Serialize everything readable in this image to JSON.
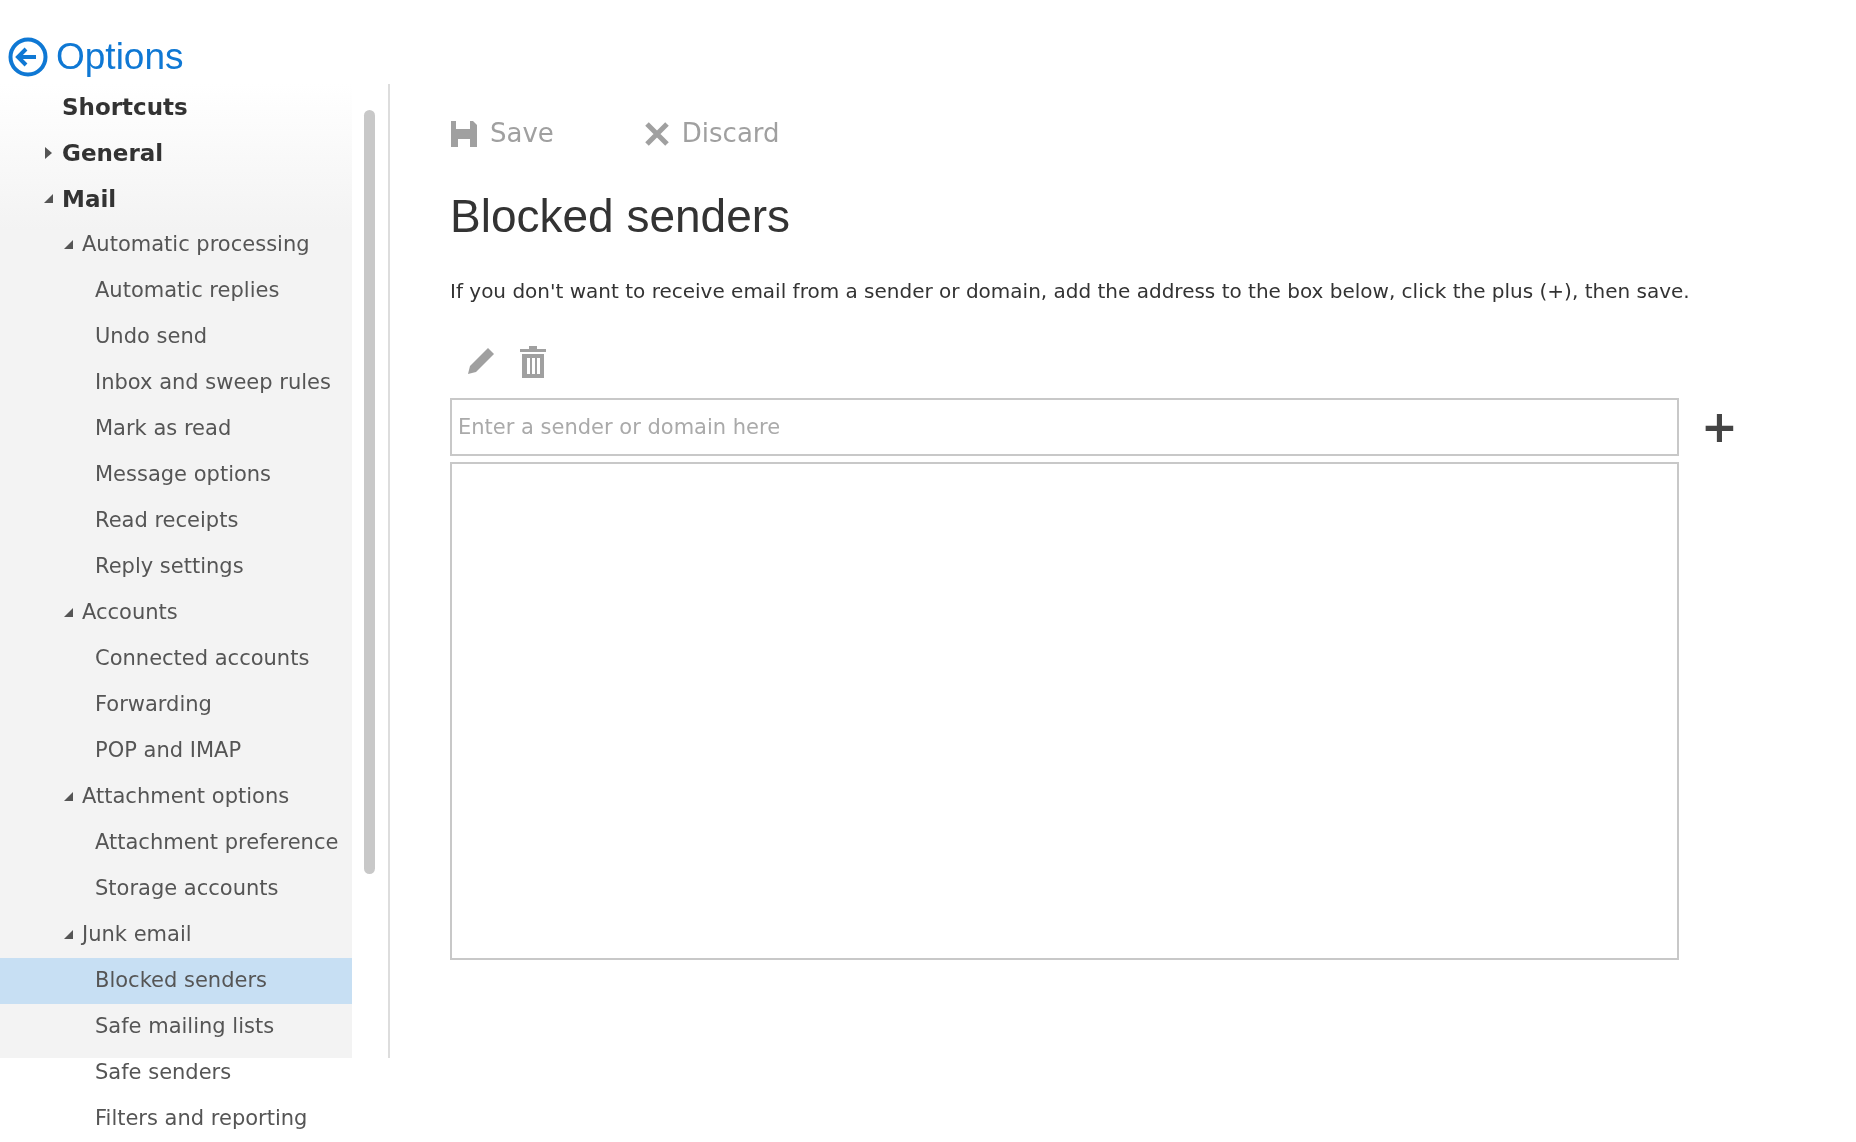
{
  "header": {
    "title": "Options"
  },
  "sidebar": {
    "items": [
      {
        "label": "Shortcuts",
        "kind": "link"
      },
      {
        "label": "General",
        "kind": "group",
        "expanded": false
      },
      {
        "label": "Mail",
        "kind": "group",
        "expanded": true,
        "children": [
          {
            "label": "Automatic processing",
            "kind": "group",
            "expanded": true,
            "children": [
              {
                "label": "Automatic replies",
                "kind": "leaf",
                "selected": false
              },
              {
                "label": "Undo send",
                "kind": "leaf",
                "selected": false
              },
              {
                "label": "Inbox and sweep rules",
                "kind": "leaf",
                "selected": false
              },
              {
                "label": "Mark as read",
                "kind": "leaf",
                "selected": false
              },
              {
                "label": "Message options",
                "kind": "leaf",
                "selected": false
              },
              {
                "label": "Read receipts",
                "kind": "leaf",
                "selected": false
              },
              {
                "label": "Reply settings",
                "kind": "leaf",
                "selected": false
              }
            ]
          },
          {
            "label": "Accounts",
            "kind": "group",
            "expanded": true,
            "children": [
              {
                "label": "Connected accounts",
                "kind": "leaf",
                "selected": false
              },
              {
                "label": "Forwarding",
                "kind": "leaf",
                "selected": false
              },
              {
                "label": "POP and IMAP",
                "kind": "leaf",
                "selected": false
              }
            ]
          },
          {
            "label": "Attachment options",
            "kind": "group",
            "expanded": true,
            "children": [
              {
                "label": "Attachment preference",
                "kind": "leaf",
                "selected": false
              },
              {
                "label": "Storage accounts",
                "kind": "leaf",
                "selected": false
              }
            ]
          },
          {
            "label": "Junk email",
            "kind": "group",
            "expanded": true,
            "children": [
              {
                "label": "Blocked senders",
                "kind": "leaf",
                "selected": true
              },
              {
                "label": "Safe mailing lists",
                "kind": "leaf",
                "selected": false
              },
              {
                "label": "Safe senders",
                "kind": "leaf",
                "selected": false
              },
              {
                "label": "Filters and reporting",
                "kind": "leaf",
                "selected": false
              }
            ]
          }
        ]
      }
    ]
  },
  "toolbar": [
    {
      "label": "Save",
      "kind": "save"
    },
    {
      "label": "Discard",
      "kind": "discard"
    }
  ],
  "page": {
    "title": "Blocked senders",
    "description": "If you don't want to receive email from a sender or domain, add the address to the box below, click the plus (+), then save.",
    "list_tools": [
      {
        "kind": "edit"
      },
      {
        "kind": "delete"
      }
    ],
    "input": {
      "placeholder": "Enter a sender or domain here"
    },
    "add_button": "+"
  }
}
